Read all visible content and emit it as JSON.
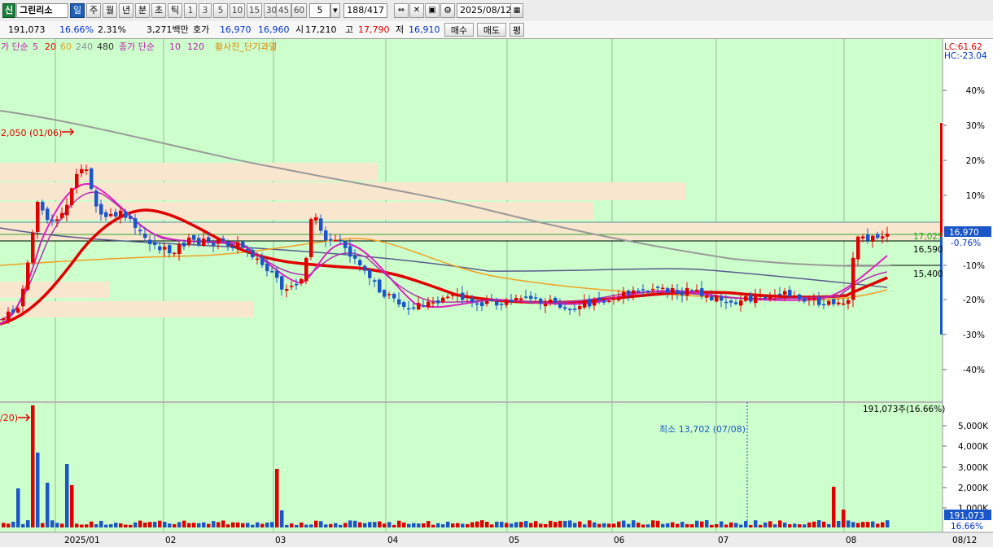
{
  "toolbar": {
    "market_badge": "신",
    "stock_name": "그린리소",
    "active_period": "일",
    "period_tabs": [
      "일",
      "주",
      "월",
      "년",
      "분",
      "초",
      "틱"
    ],
    "interval_buttons": [
      "1",
      "3",
      "5",
      "10",
      "15",
      "30",
      "45",
      "60"
    ],
    "interval_select": "5",
    "count_current": "188",
    "count_total": "/417",
    "date": "2025/08/12"
  },
  "quote": {
    "volume": "191,073",
    "change_pct": "16.66%",
    "turnover_pct": "2.31%",
    "amount": "3,271백만",
    "hoga_label": "호가",
    "ask": "16,970",
    "bid": "16,960",
    "open_label": "시",
    "open": "17,210",
    "high_label": "고",
    "high": "17,790",
    "low_label": "저",
    "low": "16,910",
    "buy_button": "매수",
    "sell_button": "매도",
    "eval_button": "평"
  },
  "legend": {
    "ma_label": "가 단순",
    "ma_5": "5",
    "ma_20": "20",
    "ma_60": "60",
    "ma_240": "240",
    "ma_480": "480",
    "close_label": "종가 단순",
    "cma_10": "10",
    "cma_120": "120",
    "signal": "황사진_단기과열"
  },
  "price_axis": {
    "lc": "LC:61.62",
    "hc": "HC:-23.04",
    "ticks": [
      "40%",
      "30%",
      "20%",
      "10%",
      "0%",
      "-10%",
      "-20%",
      "-30%",
      "-40%"
    ],
    "current_price": "16,970",
    "current_pct": "-0.76%",
    "line1": "17,025",
    "line2": "16,590",
    "line3": "15,400"
  },
  "annotations": {
    "high_marker": "2,050 (01/06)",
    "vol_marker": "/20)",
    "vol_min": "최소 13,702 (07/08)",
    "vol_current": "191,073주(16.66%)"
  },
  "volume_axis": {
    "ticks": [
      "5,000K",
      "4,000K",
      "3,000K",
      "2,000K",
      "1,000K"
    ],
    "current": "191,073",
    "current_pct": "16.66%"
  },
  "date_axis": [
    "2025/01",
    "02",
    "03",
    "04",
    "05",
    "06",
    "07",
    "08",
    "08/12"
  ],
  "colors": {
    "up": "#e00000",
    "down": "#1a56c8",
    "bg": "#ccffcc",
    "ma5": "#e020c0",
    "ma20": "#e02020",
    "ma60": "#f0a020",
    "ma240": "#909090",
    "ma480": "#505080"
  }
}
